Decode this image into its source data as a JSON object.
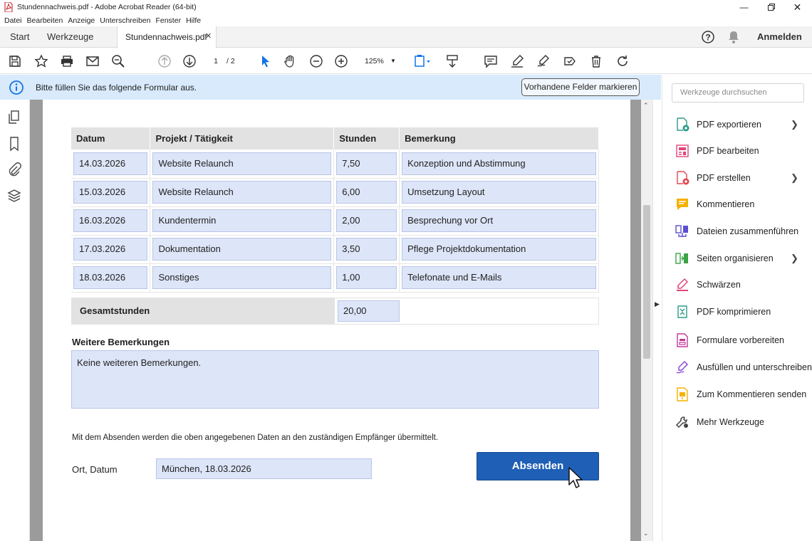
{
  "window": {
    "title": "Stundennachweis.pdf - Adobe Acrobat Reader (64-bit)"
  },
  "menu": [
    "Datei",
    "Bearbeiten",
    "Anzeige",
    "Unterschreiben",
    "Fenster",
    "Hilfe"
  ],
  "tabs": {
    "home": "Start",
    "tools": "Werkzeuge",
    "document": "Stundennachweis.pdf",
    "signin": "Anmelden"
  },
  "toolbar": {
    "page_current": "1",
    "page_total": "/ 2",
    "zoom": "125%"
  },
  "infobar": {
    "message": "Bitte füllen Sie das folgende Formular aus.",
    "button": "Vorhandene Felder markieren"
  },
  "form": {
    "columns": [
      "Datum",
      "Projekt / Tätigkeit",
      "Stunden",
      "Bemerkung"
    ],
    "rows": [
      {
        "date": "14.03.2026",
        "project": "Website Relaunch",
        "hours": "7,50",
        "note": "Konzeption und Abstimmung"
      },
      {
        "date": "15.03.2026",
        "project": "Website Relaunch",
        "hours": "6,00",
        "note": "Umsetzung Layout"
      },
      {
        "date": "16.03.2026",
        "project": "Kundentermin",
        "hours": "2,00",
        "note": "Besprechung vor Ort"
      },
      {
        "date": "17.03.2026",
        "project": "Dokumentation",
        "hours": "3,50",
        "note": "Pflege Projektdokumentation"
      },
      {
        "date": "18.03.2026",
        "project": "Sonstiges",
        "hours": "1,00",
        "note": "Telefonate und E-Mails"
      }
    ],
    "total_label": "Gesamtstunden",
    "total_value": "20,00",
    "remarks_label": "Weitere Bemerkungen",
    "remarks_value": "Keine weiteren Bemerkungen.",
    "notice": "Mit dem Absenden werden die oben angegebenen Daten an den zuständigen Empfänger übermittelt.",
    "place_date_label": "Ort, Datum",
    "place_date_value": "München, 18.03.2026",
    "submit_label": "Absenden"
  },
  "tools_panel": {
    "search_placeholder": "Werkzeuge durchsuchen",
    "items": [
      {
        "label": "PDF exportieren",
        "icon": "export-pdf-icon",
        "color": "#2d9b8a",
        "chevron": true
      },
      {
        "label": "PDF bearbeiten",
        "icon": "edit-pdf-icon",
        "color": "#e0457b",
        "chevron": false
      },
      {
        "label": "PDF erstellen",
        "icon": "create-pdf-icon",
        "color": "#e34850",
        "chevron": true
      },
      {
        "label": "Kommentieren",
        "icon": "comment-icon",
        "color": "#f5b100",
        "chevron": false
      },
      {
        "label": "Dateien zusammenführen",
        "icon": "combine-files-icon",
        "color": "#5b4fcf",
        "chevron": false
      },
      {
        "label": "Seiten organisieren",
        "icon": "organize-pages-icon",
        "color": "#3aa346",
        "chevron": true
      },
      {
        "label": "Schwärzen",
        "icon": "redact-icon",
        "color": "#e0457b",
        "chevron": false
      },
      {
        "label": "PDF komprimieren",
        "icon": "compress-pdf-icon",
        "color": "#2d9b8a",
        "chevron": false
      },
      {
        "label": "Formulare vorbereiten",
        "icon": "prepare-form-icon",
        "color": "#c2389a",
        "chevron": false
      },
      {
        "label": "Ausfüllen und unterschreiben",
        "icon": "fill-sign-icon",
        "color": "#8b4ad8",
        "chevron": false
      },
      {
        "label": "Zum Kommentieren senden",
        "icon": "send-comment-icon",
        "color": "#f5b100",
        "chevron": false
      },
      {
        "label": "Mehr Werkzeuge",
        "icon": "more-tools-icon",
        "color": "#444444",
        "chevron": false
      }
    ]
  },
  "colors": {
    "field_fill": "#dde5f8",
    "info_bar": "#d8eafc",
    "submit_button": "#1f5fb5",
    "accent": "#1473e6"
  }
}
